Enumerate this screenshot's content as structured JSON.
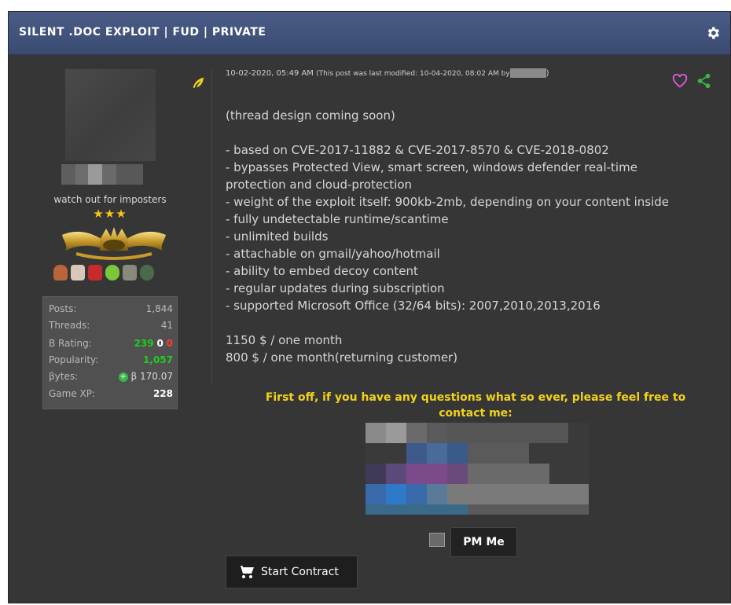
{
  "thread": {
    "title": "SILENT .DOC EXPLOIT | FUD | PRIVATE"
  },
  "user": {
    "title": "watch out for imposters",
    "stars": "★★★",
    "stats": [
      {
        "label": "Posts:",
        "value": "1,844"
      },
      {
        "label": "Threads:",
        "value": "41"
      },
      {
        "label": "B Rating:",
        "pos": "239",
        "neutral": "0",
        "neg": "0"
      },
      {
        "label": "Popularity:",
        "value": "1,057"
      },
      {
        "label": "βytes:",
        "value": "β 170.07"
      },
      {
        "label": "Game XP:",
        "value": "228"
      }
    ]
  },
  "post": {
    "date": "10-02-2020, 05:49 AM",
    "modified": "(This post was last modified: 10-04-2020, 08:02 AM by",
    "modified_end": ")",
    "lines": [
      "(thread design coming soon)",
      "",
      "- based on CVE-2017-11882 & CVE-2017-8570 & CVE-2018-0802",
      "- bypasses Protected View, smart screen, windows defender real-time",
      "protection and cloud-protection",
      "- weight of the exploit itself: 900kb-2mb, depending on your content inside",
      "- fully undetectable runtime/scantime",
      "- unlimited builds",
      "- attachable on gmail/yahoo/hotmail",
      "- ability to embed decoy content",
      "- regular updates during subscription",
      "- supported Microsoft Office (32/64 bits): 2007,2010,2013,2016",
      "",
      "1150 $ / one month",
      "800 $ / one month(returning customer)"
    ],
    "contact_line1": "First off, if you have any questions what so ever, please feel free to",
    "contact_line2": "contact me:"
  },
  "buttons": {
    "pm": "PM Me",
    "contract": "Start Contract"
  },
  "icons": {
    "settings": "gear-icon",
    "reputation": "quill-icon",
    "like": "heart-icon",
    "share": "share-icon",
    "cart": "cart-icon"
  },
  "colors": {
    "header": "#3a4b72",
    "panel": "#363636",
    "accent_yellow": "#f2d21a",
    "heart": "#d25ad2",
    "share": "#3ab54a"
  }
}
